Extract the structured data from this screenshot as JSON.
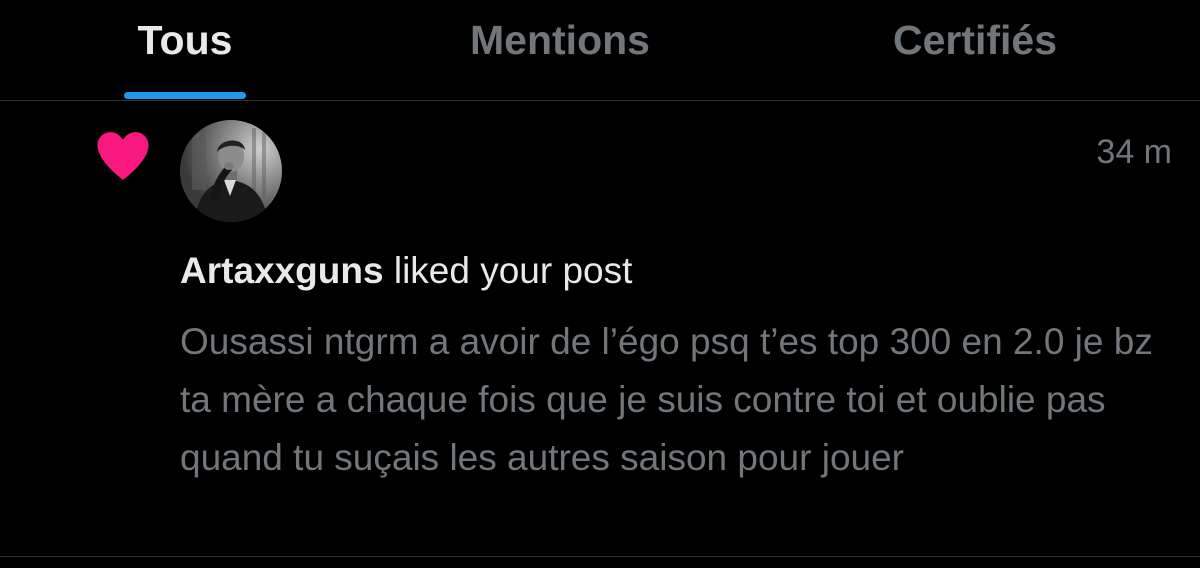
{
  "tabs": {
    "all": "Tous",
    "mentions": "Mentions",
    "verified": "Certifiés",
    "active": "all"
  },
  "notification": {
    "icon": "heart-icon",
    "icon_color": "#f91880",
    "timestamp": "34 m",
    "username": "Artaxxguns",
    "action": "liked your post",
    "post_text": "Ousassi ntgrm a avoir de l’égo psq t’es top 300 en 2.0 je bz ta mère a chaque fois que je suis contre toi et oublie pas quand tu suçais les autres saison pour jouer"
  },
  "colors": {
    "background": "#000000",
    "accent": "#1d9bf0",
    "text_primary": "#e7e9ea",
    "text_secondary": "#71767b",
    "divider": "#2f3336"
  }
}
